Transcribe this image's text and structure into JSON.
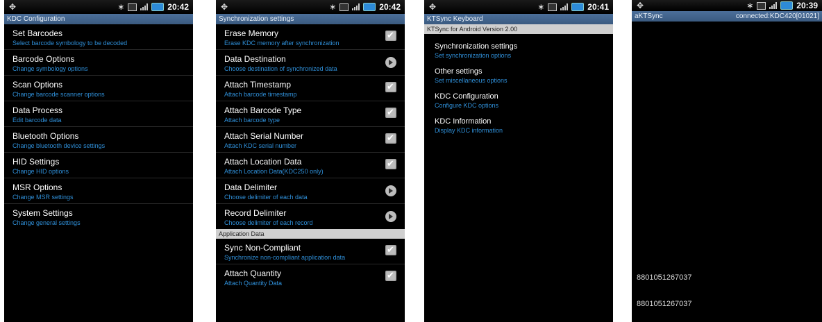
{
  "status": {
    "times": [
      "20:42",
      "20:42",
      "20:41",
      "20:39"
    ]
  },
  "screen1": {
    "title": "KDC Configuration",
    "items": [
      {
        "title": "Set Barcodes",
        "subtitle": "Select barcode symbology to be decoded"
      },
      {
        "title": "Barcode Options",
        "subtitle": "Change symbology options"
      },
      {
        "title": "Scan Options",
        "subtitle": "Change barcode scanner options"
      },
      {
        "title": "Data Process",
        "subtitle": "Edit barcode data"
      },
      {
        "title": "Bluetooth Options",
        "subtitle": "Change bluetooth device settings"
      },
      {
        "title": "HID Settings",
        "subtitle": "Change HID options"
      },
      {
        "title": "MSR Options",
        "subtitle": "Change MSR settings"
      },
      {
        "title": "System Settings",
        "subtitle": "Change general settings"
      }
    ]
  },
  "screen2": {
    "title": "Synchronization settings",
    "items": [
      {
        "title": "Erase Memory",
        "subtitle": "Erase KDC memory after synchronization",
        "control": "checkbox"
      },
      {
        "title": "Data Destination",
        "subtitle": "Choose destination of synchronized data",
        "control": "arrow"
      },
      {
        "title": "Attach Timestamp",
        "subtitle": "Attach barcode timestamp",
        "control": "checkbox"
      },
      {
        "title": "Attach Barcode Type",
        "subtitle": "Attach barcode type",
        "control": "checkbox"
      },
      {
        "title": "Attach Serial Number",
        "subtitle": "Attach KDC serial number",
        "control": "checkbox"
      },
      {
        "title": "Attach Location Data",
        "subtitle": "Attach Location Data(KDC250 only)",
        "control": "checkbox"
      },
      {
        "title": "Data Delimiter",
        "subtitle": "Choose delimiter of each data",
        "control": "arrow"
      },
      {
        "title": "Record Delimiter",
        "subtitle": "Choose delimiter of each record",
        "control": "arrow"
      }
    ],
    "section": "Application Data",
    "app_items": [
      {
        "title": "Sync Non-Compliant",
        "subtitle": "Synchronize non-compliant application data",
        "control": "checkbox"
      },
      {
        "title": "Attach Quantity",
        "subtitle": "Attach Quantity Data",
        "control": "checkbox"
      }
    ]
  },
  "screen3": {
    "title": "KTSync Keyboard",
    "version": "KTSync for Android Version 2.00",
    "items": [
      {
        "title": "Synchronization settings",
        "subtitle": "Set synchronization options"
      },
      {
        "title": "Other settings",
        "subtitle": "Set miscellaneous options"
      },
      {
        "title": "KDC Configuration",
        "subtitle": "Configure KDC options"
      },
      {
        "title": "KDC Information",
        "subtitle": "Display KDC information"
      }
    ]
  },
  "screen4": {
    "title": "aKTSync",
    "connection": "connected:KDC420[01021]",
    "scans": [
      "8801051267037",
      "8801051267037"
    ]
  }
}
